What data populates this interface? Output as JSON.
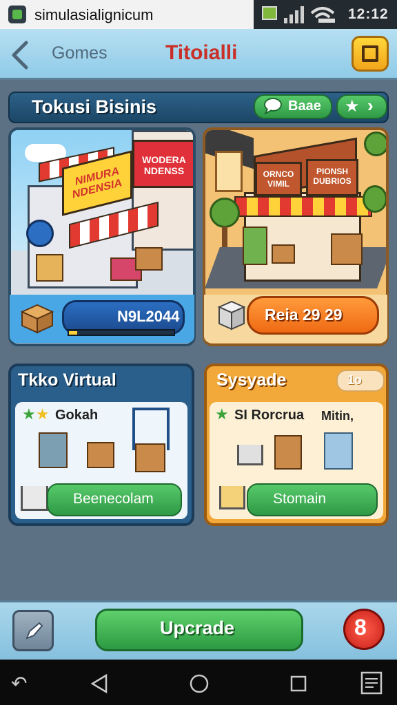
{
  "status_bar": {
    "app_name": "simulasialignicum",
    "time": "12:12",
    "icons": [
      "app-icon",
      "notification-icon",
      "signal-icon",
      "wifi-icon"
    ]
  },
  "header": {
    "back_icon": "chevron-left-icon",
    "nav_label": "Gomes",
    "title": "Titoialli",
    "menu_icon": "book-icon"
  },
  "section": {
    "title": "Tokusi Bisinis",
    "share_label": "Baae",
    "rate_icon": "star-icon"
  },
  "shop_cards": [
    {
      "sign_main": "NIMURA NDENSIA",
      "sign_side": "WODERA NDENSS",
      "value": "N9L2044",
      "progress": 0.08,
      "icon": "box-icon",
      "accent": "#2b6ec2"
    },
    {
      "sign_main": "ORNCO VIMIL",
      "sign_side": "PIONSH DUBRIOS",
      "value": "Reia 29  29",
      "icon": "shopping-box-icon",
      "accent": "#ef6a14"
    }
  ],
  "virtual_store": {
    "title": "Tkko Virtual",
    "label": "Gokah",
    "button_label": "Beenecolam",
    "icons": [
      "star-icon",
      "star-icon",
      "storage-crate-icon",
      "box-icon",
      "shop-stall-icon",
      "shopping-cart-icon"
    ]
  },
  "supply_store": {
    "title": "Sysyade",
    "badge": "1o",
    "label": "SI Rorcrua",
    "label2": "Mitin,",
    "button_label": "Stomain",
    "icons": [
      "star-icon",
      "shopping-cart-icon",
      "box-icon",
      "crate-icon",
      "shopping-cart-icon"
    ]
  },
  "bottom_bar": {
    "edit_icon": "pencil-icon",
    "upgrade_label": "Upcrade",
    "alert_label": "8"
  },
  "nav_bar": {
    "icons": [
      "return-icon",
      "back-triangle-icon",
      "home-circle-icon",
      "recents-square-icon",
      "notes-icon"
    ]
  },
  "colors": {
    "header_title": "#c92f26",
    "green_button": "#2c9a42",
    "orange": "#ef6a14",
    "navy": "#1c4767"
  }
}
